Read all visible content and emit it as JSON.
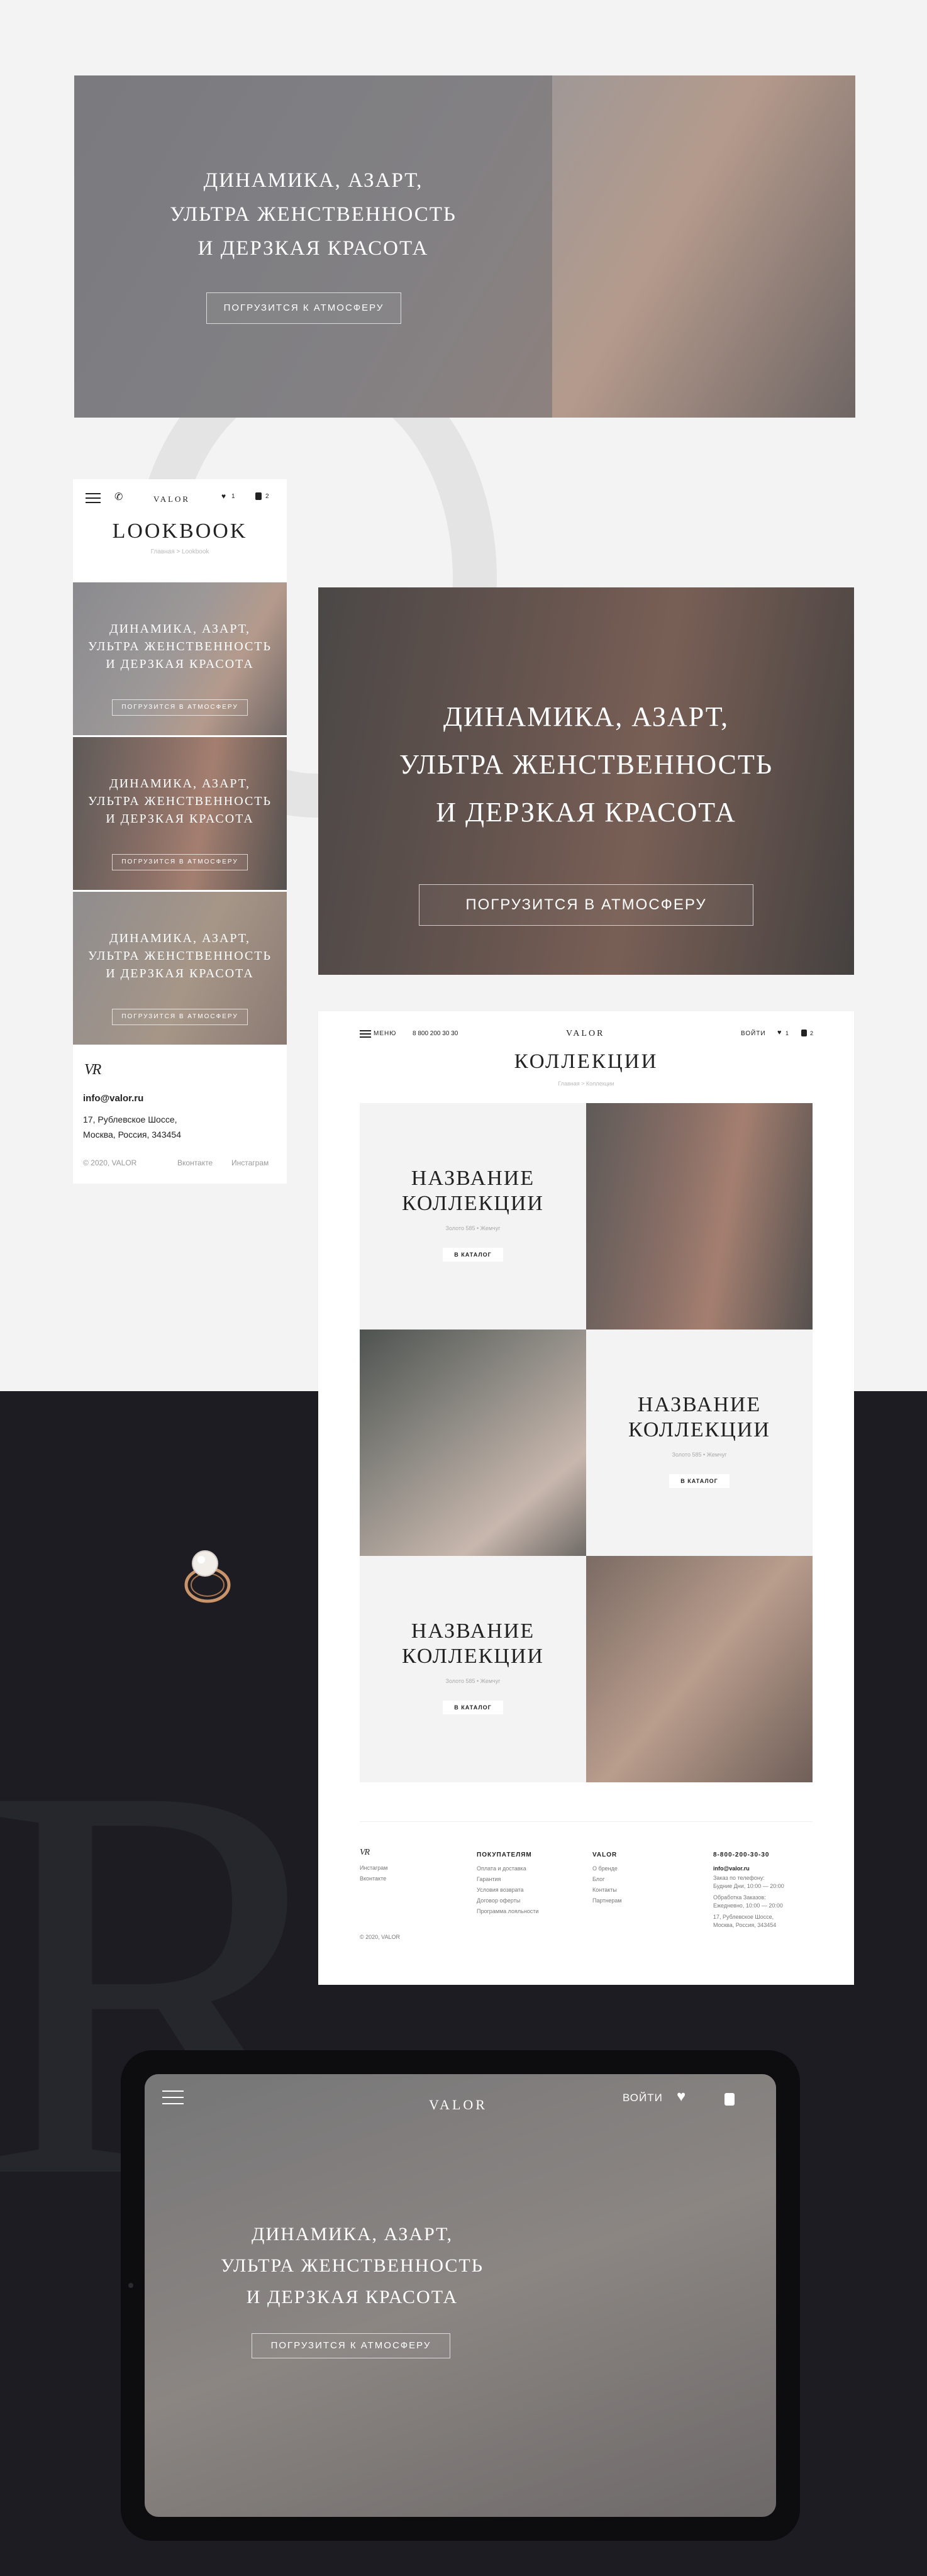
{
  "brand": {
    "name": "VALOR",
    "logo_mark": "VR"
  },
  "hero": {
    "title_lines": [
      "ДИНАМИКА, АЗАРТ,",
      "УЛЬТРА ЖЕНСТВЕННОСТЬ",
      "И ДЕРЗКАЯ КРАСОТА"
    ],
    "cta_top": "ПОГРУЗИТСЯ К АТМОСФЕРУ",
    "cta_mid": "ПОГРУЗИТСЯ В АТМОСФЕРУ",
    "cta_mobile": "ПОГРУЗИТСЯ В АТМОСФЕРУ",
    "cta_tablet": "ПОГРУЗИТСЯ К АТМОСФЕРУ"
  },
  "mobile": {
    "heart_count": "1",
    "bag_count": "2",
    "page_title": "LOOKBOOK",
    "breadcrumb": "Главная > Lookbook",
    "email": "info@valor.ru",
    "address_line1": "17, Рублевское Шоссе,",
    "address_line2": "Москва, Россия, 343454",
    "copyright": "© 2020, VALOR",
    "social_vk": "Вконтакте",
    "social_ig": "Инстаграм"
  },
  "desktop": {
    "menu_label": "МЕНЮ",
    "phone": "8 800 200 30 30",
    "login": "ВОЙТИ",
    "heart_count": "1",
    "bag_count": "2",
    "page_title": "КОЛЛЕКЦИИ",
    "breadcrumb": "Главная > Коллекции",
    "collections": [
      {
        "title_line1": "НАЗВАНИЕ",
        "title_line2": "КОЛЛЕКЦИИ",
        "subtitle": "Золото 585 • Жемчуг",
        "button": "В КАТАЛОГ"
      },
      {
        "title_line1": "НАЗВАНИЕ",
        "title_line2": "КОЛЛЕКЦИИ",
        "subtitle": "Золото 585 • Жемчуг",
        "button": "В КАТАЛОГ"
      },
      {
        "title_line1": "НАЗВАНИЕ",
        "title_line2": "КОЛЛЕКЦИИ",
        "subtitle": "Золото 585 • Жемчуг",
        "button": "В КАТАЛОГ"
      }
    ],
    "footer": {
      "social": [
        "Инстаграм",
        "Вконтакте"
      ],
      "copyright": "© 2020, VALOR",
      "buyers_title": "ПОКУПАТЕЛЯМ",
      "buyers_links": [
        "Оплата и доставка",
        "Гарантия",
        "Условия возврата",
        "Договор оферты",
        "Программа лояльности"
      ],
      "valor_title": "VALOR",
      "valor_links": [
        "О бренде",
        "Блог",
        "Контакты",
        "Партнерам"
      ],
      "phone": "8-800-200-30-30",
      "email": "info@valor.ru",
      "hours_1a": "Заказ по телефону:",
      "hours_1b": "Будние Дни, 10:00 — 20:00",
      "hours_2a": "Обработка Заказов:",
      "hours_2b": "Ежедневно, 10:00 — 20:00",
      "address_a": "17, Рублевское Шоссе,",
      "address_b": "Москва, Россия, 343454"
    }
  },
  "tablet": {
    "login": "ВОЙТИ"
  }
}
